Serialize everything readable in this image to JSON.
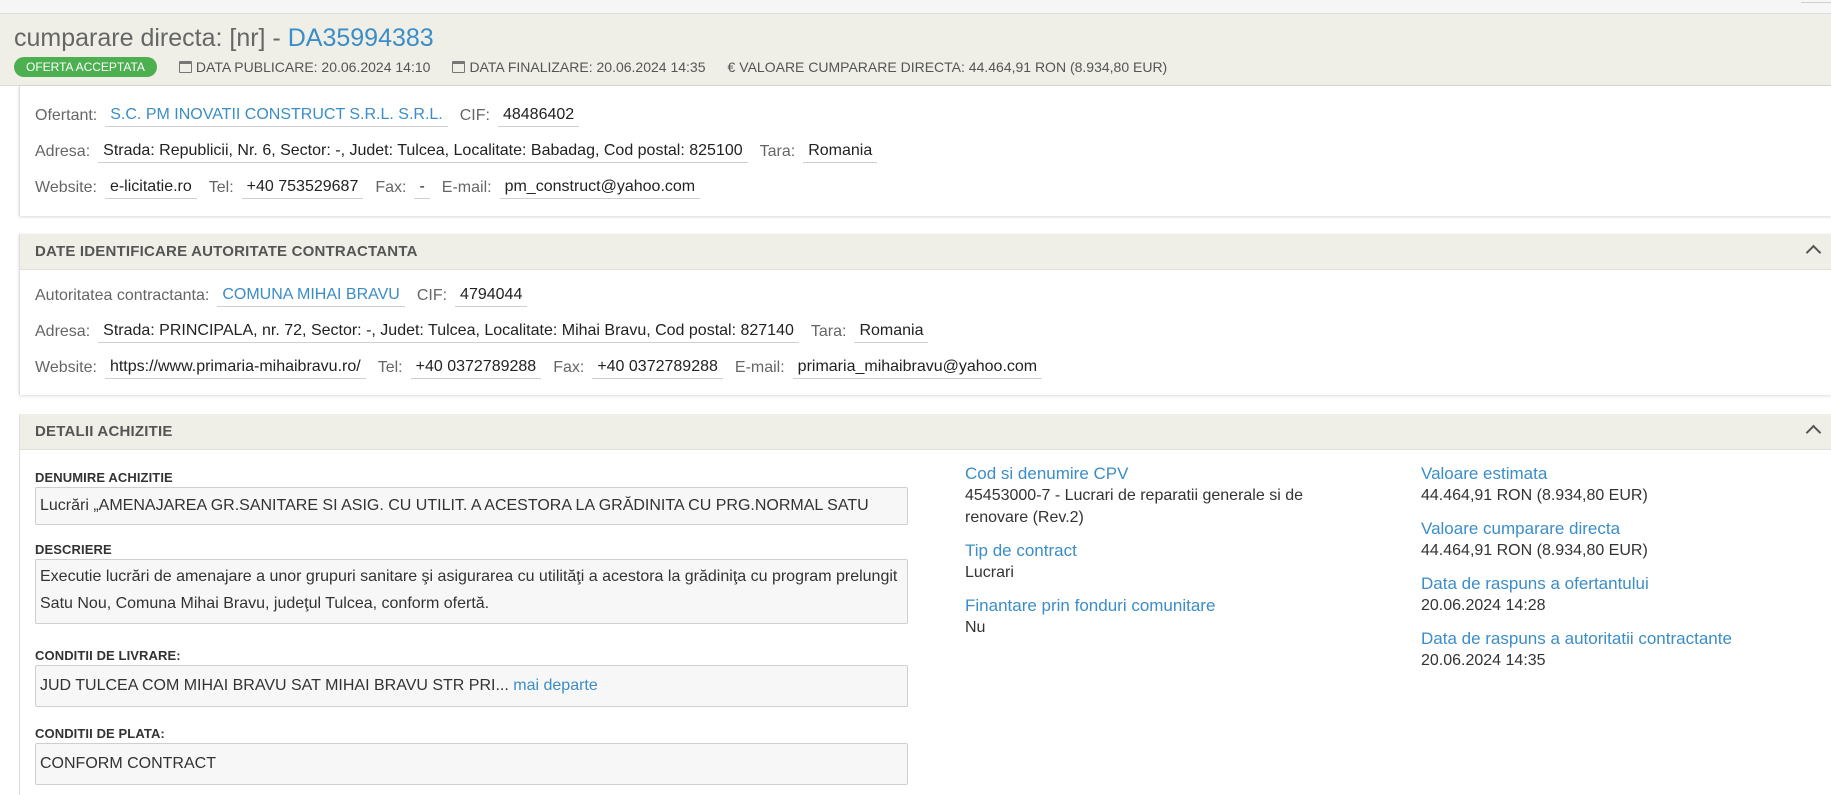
{
  "header": {
    "title_prefix": "cumparare directa: [nr] - ",
    "title_code": "DA35994383",
    "status_badge": "OFERTA ACCEPTATA",
    "publish_date": "DATA PUBLICARE: 20.06.2024 14:10",
    "end_date": "DATA FINALIZARE: 20.06.2024 14:35",
    "direct_value": "VALOARE CUMPARARE DIRECTA: 44.464,91  RON (8.934,80  EUR)",
    "currency_symbol": "€"
  },
  "offerer": {
    "label": "Ofertant:",
    "name": "S.C. PM INOVATII CONSTRUCT S.R.L. S.R.L.",
    "cif_label": "CIF:",
    "cif": "48486402",
    "address_label": "Adresa:",
    "address": "Strada: Republicii, Nr. 6, Sector: -, Judet: Tulcea, Localitate: Babadag, Cod postal: 825100",
    "country_label": "Tara:",
    "country": "Romania",
    "website_label": "Website:",
    "website": "e-licitatie.ro",
    "tel_label": "Tel:",
    "tel": "+40 753529687",
    "fax_label": "Fax:",
    "fax": "-",
    "email_label": "E-mail:",
    "email": "pm_construct@yahoo.com"
  },
  "authority": {
    "section_title": "DATE IDENTIFICARE AUTORITATE CONTRACTANTA",
    "label": "Autoritatea contractanta:",
    "name": "COMUNA MIHAI BRAVU",
    "cif_label": "CIF:",
    "cif": "4794044",
    "address_label": "Adresa:",
    "address": "Strada: PRINCIPALA, nr. 72, Sector: -, Judet: Tulcea, Localitate: Mihai Bravu, Cod postal: 827140",
    "country_label": "Tara:",
    "country": "Romania",
    "website_label": "Website:",
    "website": "https://www.primaria-mihaibravu.ro/",
    "tel_label": "Tel:",
    "tel": "+40 0372789288",
    "fax_label": "Fax:",
    "fax": "+40 0372789288",
    "email_label": "E-mail:",
    "email": "primaria_mihaibravu@yahoo.com"
  },
  "acquisition": {
    "section_title": "DETALII ACHIZITIE",
    "name_label": "DENUMIRE ACHIZITIE",
    "name_value": "Lucrări „AMENAJAREA GR.SANITARE SI ASIG. CU UTILIT. A ACESTORA LA GRĂDINITA CU PRG.NORMAL SATU NOU”",
    "description_label": "DESCRIERE",
    "description_value": "Executie lucrări de amenajare a unor grupuri sanitare şi asigurarea cu utilităţi a acestora la grădiniţa cu program prelungit Satu Nou, Comuna Mihai Bravu, judeţul Tulcea, conform ofertă.",
    "delivery_label": "CONDITII DE LIVRARE:",
    "delivery_value": "JUD TULCEA COM MIHAI BRAVU SAT MIHAI BRAVU STR PRI...",
    "delivery_more": "mai departe",
    "payment_label": "CONDITII DE PLATA:",
    "payment_value": "CONFORM CONTRACT",
    "cpv_title": "Cod si denumire CPV",
    "cpv_value": "45453000-7 - Lucrari de reparatii generale si de renovare (Rev.2)",
    "contract_type_title": "Tip de contract",
    "contract_type_value": "Lucrari",
    "eu_funds_title": "Finantare prin fonduri comunitare",
    "eu_funds_value": "Nu",
    "estimated_value_title": "Valoare estimata",
    "estimated_value": "44.464,91  RON (8.934,80  EUR)",
    "direct_value_title": "Valoare cumparare directa",
    "direct_value": "44.464,91  RON (8.934,80  EUR)",
    "offerer_response_title": "Data de raspuns a ofertantului",
    "offerer_response_value": "20.06.2024 14:28",
    "authority_response_title": "Data de raspuns a autoritatii contractante",
    "authority_response_value": "20.06.2024 14:35"
  },
  "colors": {
    "accent": "#3b8dc8",
    "badge": "#4caf50",
    "header_bg": "#efefe7"
  }
}
